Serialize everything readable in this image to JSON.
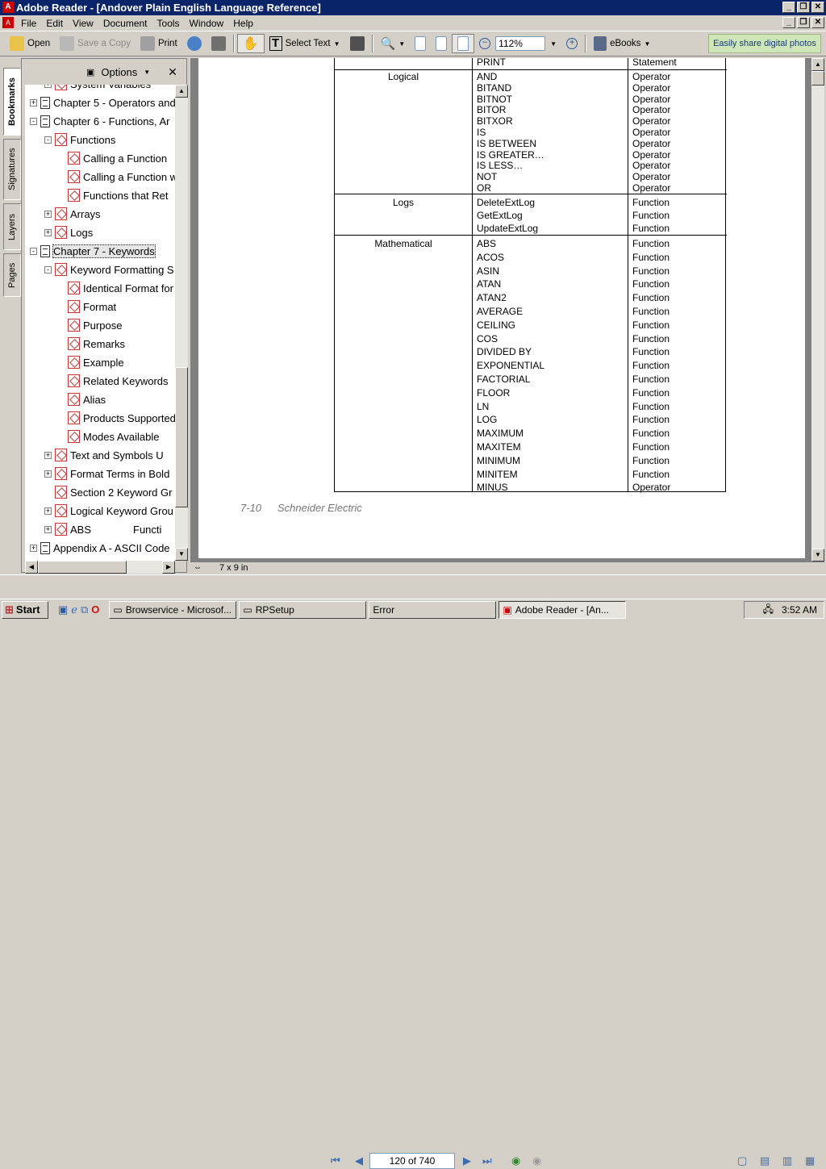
{
  "window": {
    "title": "Adobe Reader - [Andover Plain English Language Reference]"
  },
  "menu": [
    "File",
    "Edit",
    "View",
    "Document",
    "Tools",
    "Window",
    "Help"
  ],
  "toolbar": {
    "open": "Open",
    "save_copy": "Save a Copy",
    "print": "Print",
    "select_text": "Select Text",
    "zoom": "112%",
    "ebooks": "eBooks",
    "ad": "Easily share digital photos"
  },
  "nav_tabs": [
    "Bookmarks",
    "Signatures",
    "Layers",
    "Pages"
  ],
  "panel": {
    "options": "Options",
    "items": [
      {
        "label": "System Variables",
        "level": 1,
        "exp": "+",
        "icon": "bookmark"
      },
      {
        "label": "Chapter 5 - Operators and",
        "level": 0,
        "exp": "+",
        "icon": "doc"
      },
      {
        "label": "Chapter 6 - Functions, Ar",
        "level": 0,
        "exp": "-",
        "icon": "doc"
      },
      {
        "label": "Functions",
        "level": 1,
        "exp": "-",
        "icon": "bookmark"
      },
      {
        "label": "Calling a Function",
        "level": 2,
        "exp": "",
        "icon": "bookmark"
      },
      {
        "label": "Calling a Function w",
        "level": 2,
        "exp": "",
        "icon": "bookmark"
      },
      {
        "label": "Functions that Ret",
        "level": 2,
        "exp": "",
        "icon": "bookmark"
      },
      {
        "label": "Arrays",
        "level": 1,
        "exp": "+",
        "icon": "bookmark"
      },
      {
        "label": "Logs",
        "level": 1,
        "exp": "+",
        "icon": "bookmark"
      },
      {
        "label": "Chapter 7 - Keywords",
        "level": 0,
        "exp": "-",
        "icon": "doc",
        "selected": true
      },
      {
        "label": "Keyword Formatting S",
        "level": 1,
        "exp": "-",
        "icon": "bookmark"
      },
      {
        "label": "Identical Format for",
        "level": 2,
        "exp": "",
        "icon": "bookmark"
      },
      {
        "label": "Format",
        "level": 2,
        "exp": "",
        "icon": "bookmark"
      },
      {
        "label": "Purpose",
        "level": 2,
        "exp": "",
        "icon": "bookmark"
      },
      {
        "label": "Remarks",
        "level": 2,
        "exp": "",
        "icon": "bookmark"
      },
      {
        "label": "Example",
        "level": 2,
        "exp": "",
        "icon": "bookmark"
      },
      {
        "label": "Related Keywords",
        "level": 2,
        "exp": "",
        "icon": "bookmark"
      },
      {
        "label": "Alias",
        "level": 2,
        "exp": "",
        "icon": "bookmark"
      },
      {
        "label": "Products Supported",
        "level": 2,
        "exp": "",
        "icon": "bookmark"
      },
      {
        "label": "Modes Available",
        "level": 2,
        "exp": "",
        "icon": "bookmark"
      },
      {
        "label": "Text and Symbols U",
        "level": 1,
        "exp": "+",
        "icon": "bookmark"
      },
      {
        "label": "Format Terms in Bold",
        "level": 1,
        "exp": "+",
        "icon": "bookmark"
      },
      {
        "label": "Section 2 Keyword Gr",
        "level": 1,
        "exp": "",
        "icon": "bookmark"
      },
      {
        "label": "Logical Keyword Grou",
        "level": 1,
        "exp": "+",
        "icon": "bookmark"
      },
      {
        "label": "ABS",
        "level": 1,
        "exp": "+",
        "icon": "bookmark",
        "extra": "Functi"
      },
      {
        "label": "Appendix A - ASCII Code",
        "level": 0,
        "exp": "+",
        "icon": "doc"
      }
    ]
  },
  "table": {
    "top": {
      "keyword": "PRINT",
      "type": "Statement"
    },
    "groups": [
      {
        "name": "Logical",
        "rows": [
          [
            "AND",
            "Operator"
          ],
          [
            "BITAND",
            "Operator"
          ],
          [
            "BITNOT",
            "Operator"
          ],
          [
            "BITOR",
            "Operator"
          ],
          [
            "BITXOR",
            "Operator"
          ],
          [
            "IS",
            "Operator"
          ],
          [
            "IS BETWEEN",
            "Operator"
          ],
          [
            "IS GREATER…",
            "Operator"
          ],
          [
            "IS LESS…",
            "Operator"
          ],
          [
            "NOT",
            "Operator"
          ],
          [
            "OR",
            "Operator"
          ]
        ]
      },
      {
        "name": "Logs",
        "rows": [
          [
            "DeleteExtLog",
            "Function"
          ],
          [
            "GetExtLog",
            "Function"
          ],
          [
            "UpdateExtLog",
            "Function"
          ]
        ]
      },
      {
        "name": "Mathematical",
        "rows": [
          [
            "ABS",
            "Function"
          ],
          [
            "ACOS",
            "Function"
          ],
          [
            "ASIN",
            "Function"
          ],
          [
            "ATAN",
            "Function"
          ],
          [
            "ATAN2",
            "Function"
          ],
          [
            "AVERAGE",
            "Function"
          ],
          [
            "CEILING",
            "Function"
          ],
          [
            "COS",
            "Function"
          ],
          [
            "DIVIDED BY",
            "Function"
          ],
          [
            "EXPONENTIAL",
            "Function"
          ],
          [
            "FACTORIAL",
            "Function"
          ],
          [
            "FLOOR",
            "Function"
          ],
          [
            "LN",
            "Function"
          ],
          [
            "LOG",
            "Function"
          ],
          [
            "MAXIMUM",
            "Function"
          ],
          [
            "MAXITEM",
            "Function"
          ],
          [
            "MINIMUM",
            "Function"
          ],
          [
            "MINITEM",
            "Function"
          ],
          [
            "MINUS",
            "Operator"
          ]
        ]
      }
    ]
  },
  "footer": {
    "page": "7-10",
    "company": "Schneider Electric"
  },
  "page_size": "7 x 9 in",
  "page_nav": "120 of 740",
  "taskbar": {
    "start": "Start",
    "tasks": [
      "Browservice - Microsof...",
      "RPSetup",
      "Error",
      "Adobe Reader - [An..."
    ],
    "clock": "3:52 AM"
  }
}
